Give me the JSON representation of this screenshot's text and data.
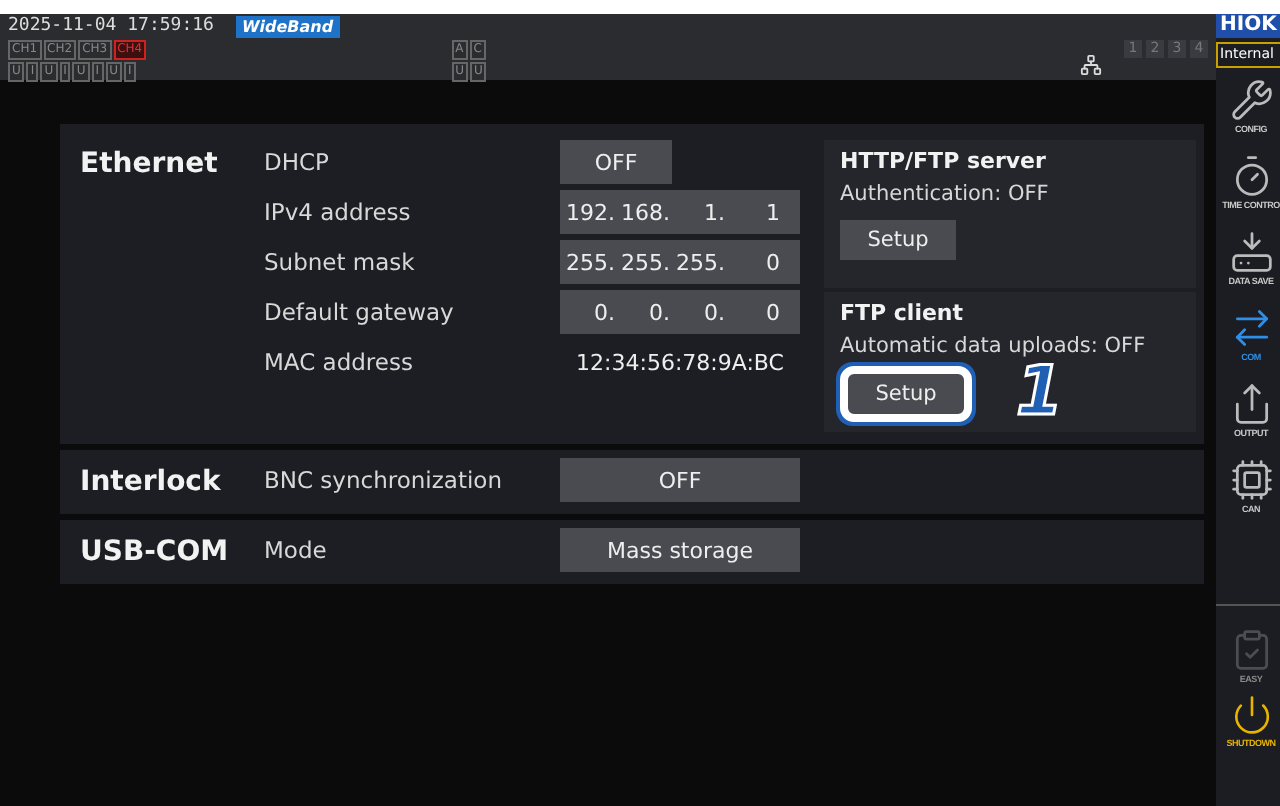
{
  "header": {
    "datetime": "2025-11-04 17:59:16",
    "mode_badge": "WideBand",
    "channels": [
      {
        "label": "CH1",
        "alert": false
      },
      {
        "label": "CH2",
        "alert": false
      },
      {
        "label": "CH3",
        "alert": false
      },
      {
        "label": "CH4",
        "alert": true
      }
    ],
    "channel_params": [
      "U",
      "I",
      "U",
      "I",
      "U",
      "I",
      "U",
      "I"
    ],
    "aux_labels": [
      "A",
      "C"
    ],
    "aux_params": [
      "U",
      "U"
    ],
    "slots": [
      "1",
      "2",
      "3",
      "4"
    ]
  },
  "sections": [
    {
      "title": "Ethernet",
      "rows": [
        {
          "label": "DHCP",
          "kind": "button",
          "value": "OFF"
        },
        {
          "label": "IPv4 address",
          "kind": "ip",
          "octets": [
            "192.",
            "168.",
            "1.",
            "1"
          ]
        },
        {
          "label": "Subnet mask",
          "kind": "ip",
          "octets": [
            "255.",
            "255.",
            "255.",
            "0"
          ]
        },
        {
          "label": "Default gateway",
          "kind": "ip",
          "octets": [
            "0.",
            "0.",
            "0.",
            "0"
          ]
        },
        {
          "label": "MAC address",
          "kind": "text",
          "value": "12:34:56:78:9A:BC"
        }
      ],
      "panels": [
        {
          "title": "HTTP/FTP server",
          "status": "Authentication: OFF",
          "button": "Setup",
          "highlighted": false
        },
        {
          "title": "FTP client",
          "status": "Automatic data uploads: OFF",
          "button": "Setup",
          "highlighted": true
        }
      ]
    },
    {
      "title": "Interlock",
      "rows": [
        {
          "label": "BNC synchronization",
          "kind": "wide-button",
          "value": "OFF"
        }
      ]
    },
    {
      "title": "USB-COM",
      "rows": [
        {
          "label": "Mode",
          "kind": "wide-button",
          "value": "Mass storage"
        }
      ]
    }
  ],
  "callout": "1",
  "sidebar": {
    "brand": "HIOK",
    "source": "Internal",
    "items": [
      {
        "label": "CONFIG",
        "kind": "config",
        "selected": false,
        "disabled": false,
        "color": "#c8c8c8"
      },
      {
        "label": "TIME CONTRO",
        "kind": "timer",
        "selected": false,
        "disabled": false,
        "color": "#c8c8c8"
      },
      {
        "label": "DATA SAVE",
        "kind": "save",
        "selected": false,
        "disabled": false,
        "color": "#c8c8c8"
      },
      {
        "label": "COM",
        "kind": "com",
        "selected": true,
        "disabled": false,
        "color": "#2f8fe8"
      },
      {
        "label": "OUTPUT",
        "kind": "output",
        "selected": false,
        "disabled": false,
        "color": "#c8c8c8"
      },
      {
        "label": "CAN",
        "kind": "can",
        "selected": false,
        "disabled": false,
        "color": "#c8c8c8"
      },
      {
        "label": "EASY",
        "kind": "easy",
        "selected": false,
        "disabled": true,
        "color": "#8a8a8a"
      },
      {
        "label": "SHUTDOWN",
        "kind": "shutdown",
        "selected": false,
        "disabled": false,
        "color": "#e8b400"
      }
    ]
  }
}
